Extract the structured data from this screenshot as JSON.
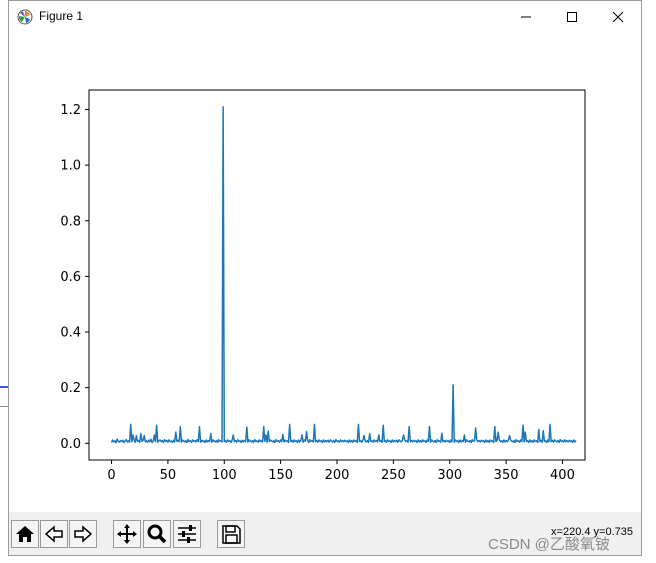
{
  "window": {
    "title": "Figure 1",
    "minimize_label": "–",
    "maximize_label": "☐",
    "close_label": "✕"
  },
  "toolbar": {
    "buttons": [
      {
        "name": "home-button",
        "icon": "home-icon"
      },
      {
        "name": "back-button",
        "icon": "arrow-left-icon"
      },
      {
        "name": "forward-button",
        "icon": "arrow-right-icon"
      },
      {
        "name": "pan-button",
        "icon": "move-icon"
      },
      {
        "name": "zoom-button",
        "icon": "magnifier-icon"
      },
      {
        "name": "configure-subplots-button",
        "icon": "sliders-icon"
      },
      {
        "name": "save-button",
        "icon": "floppy-disk-icon"
      }
    ],
    "coords": "x=220.4 y=0.735"
  },
  "watermark": "CSDN @乙酸氧铍",
  "chart_data": {
    "type": "line",
    "title": "",
    "xlabel": "",
    "ylabel": "",
    "xlim": [
      -20,
      420
    ],
    "ylim": [
      -0.06,
      1.27
    ],
    "xticks": [
      0,
      50,
      100,
      150,
      200,
      250,
      300,
      350,
      400
    ],
    "yticks": [
      0.0,
      0.2,
      0.4,
      0.6,
      0.8,
      1.0,
      1.2
    ],
    "ytick_labels": [
      "0.0",
      "0.2",
      "0.4",
      "0.6",
      "0.8",
      "1.0",
      "1.2"
    ],
    "line_color": "#1f77b4",
    "series": [
      {
        "x_start": 0,
        "x_step": 1,
        "values": [
          0.003,
          0.012,
          0.005,
          0.009,
          0.002,
          0.015,
          0.007,
          0.004,
          0.01,
          0.006,
          0.011,
          0.003,
          0.008,
          0.013,
          0.005,
          0.009,
          0.004,
          0.068,
          0.006,
          0.03,
          0.012,
          0.004,
          0.028,
          0.006,
          0.01,
          0.004,
          0.035,
          0.007,
          0.011,
          0.028,
          0.005,
          0.009,
          0.004,
          0.012,
          0.006,
          0.014,
          0.003,
          0.008,
          0.03,
          0.006,
          0.065,
          0.004,
          0.009,
          0.012,
          0.006,
          0.01,
          0.003,
          0.013,
          0.007,
          0.01,
          0.004,
          0.012,
          0.006,
          0.008,
          0.003,
          0.011,
          0.005,
          0.04,
          0.007,
          0.01,
          0.006,
          0.06,
          0.004,
          0.012,
          0.008,
          0.005,
          0.01,
          0.003,
          0.014,
          0.006,
          0.009,
          0.004,
          0.012,
          0.007,
          0.01,
          0.005,
          0.013,
          0.006,
          0.06,
          0.004,
          0.011,
          0.007,
          0.009,
          0.003,
          0.012,
          0.005,
          0.01,
          0.006,
          0.035,
          0.004,
          0.012,
          0.008,
          0.005,
          0.01,
          0.003,
          0.013,
          0.007,
          0.009,
          0.005,
          1.21,
          0.006,
          0.01,
          0.004,
          0.012,
          0.007,
          0.009,
          0.003,
          0.012,
          0.03,
          0.006,
          0.01,
          0.004,
          0.013,
          0.007,
          0.009,
          0.003,
          0.011,
          0.005,
          0.01,
          0.006,
          0.058,
          0.004,
          0.012,
          0.008,
          0.005,
          0.01,
          0.003,
          0.013,
          0.007,
          0.009,
          0.004,
          0.012,
          0.006,
          0.01,
          0.005,
          0.06,
          0.007,
          0.03,
          0.004,
          0.044,
          0.006,
          0.012,
          0.008,
          0.005,
          0.01,
          0.003,
          0.013,
          0.007,
          0.009,
          0.004,
          0.012,
          0.006,
          0.032,
          0.005,
          0.011,
          0.007,
          0.009,
          0.003,
          0.068,
          0.006,
          0.01,
          0.004,
          0.012,
          0.007,
          0.009,
          0.003,
          0.012,
          0.005,
          0.01,
          0.03,
          0.004,
          0.012,
          0.008,
          0.042,
          0.01,
          0.003,
          0.013,
          0.007,
          0.009,
          0.005,
          0.068,
          0.006,
          0.01,
          0.004,
          0.012,
          0.007,
          0.009,
          0.003,
          0.012,
          0.005,
          0.01,
          0.006,
          0.011,
          0.004,
          0.012,
          0.008,
          0.005,
          0.01,
          0.003,
          0.013,
          0.007,
          0.009,
          0.004,
          0.012,
          0.006,
          0.01,
          0.005,
          0.011,
          0.007,
          0.009,
          0.003,
          0.012,
          0.005,
          0.01,
          0.004,
          0.012,
          0.007,
          0.009,
          0.003,
          0.068,
          0.006,
          0.01,
          0.004,
          0.012,
          0.028,
          0.008,
          0.005,
          0.01,
          0.003,
          0.035,
          0.007,
          0.009,
          0.004,
          0.012,
          0.006,
          0.01,
          0.005,
          0.03,
          0.007,
          0.009,
          0.003,
          0.065,
          0.006,
          0.01,
          0.004,
          0.012,
          0.007,
          0.009,
          0.003,
          0.012,
          0.005,
          0.01,
          0.006,
          0.011,
          0.004,
          0.012,
          0.008,
          0.005,
          0.01,
          0.03,
          0.013,
          0.007,
          0.009,
          0.004,
          0.06,
          0.006,
          0.01,
          0.005,
          0.011,
          0.007,
          0.009,
          0.003,
          0.012,
          0.005,
          0.01,
          0.004,
          0.012,
          0.007,
          0.009,
          0.003,
          0.012,
          0.006,
          0.06,
          0.004,
          0.012,
          0.008,
          0.005,
          0.01,
          0.003,
          0.013,
          0.007,
          0.009,
          0.004,
          0.036,
          0.006,
          0.01,
          0.005,
          0.011,
          0.007,
          0.009,
          0.003,
          0.012,
          0.005,
          0.21,
          0.004,
          0.012,
          0.007,
          0.009,
          0.003,
          0.012,
          0.005,
          0.01,
          0.006,
          0.03,
          0.004,
          0.012,
          0.008,
          0.005,
          0.01,
          0.003,
          0.013,
          0.007,
          0.009,
          0.055,
          0.012,
          0.006,
          0.01,
          0.005,
          0.011,
          0.007,
          0.009,
          0.003,
          0.012,
          0.005,
          0.01,
          0.004,
          0.012,
          0.007,
          0.009,
          0.003,
          0.06,
          0.006,
          0.01,
          0.04,
          0.012,
          0.007,
          0.009,
          0.003,
          0.012,
          0.005,
          0.01,
          0.006,
          0.011,
          0.028,
          0.012,
          0.008,
          0.005,
          0.01,
          0.003,
          0.013,
          0.007,
          0.009,
          0.004,
          0.012,
          0.006,
          0.065,
          0.005,
          0.04,
          0.007,
          0.009,
          0.003,
          0.012,
          0.005,
          0.01,
          0.004,
          0.012,
          0.007,
          0.009,
          0.003,
          0.05,
          0.006,
          0.01,
          0.004,
          0.045,
          0.007,
          0.009,
          0.003,
          0.012,
          0.005,
          0.068,
          0.006,
          0.011,
          0.004,
          0.012,
          0.008,
          0.005,
          0.01,
          0.003,
          0.013,
          0.007,
          0.009,
          0.004,
          0.012,
          0.006,
          0.01,
          0.005,
          0.011,
          0.007,
          0.009,
          0.003,
          0.012,
          0.005,
          0.01
        ]
      }
    ]
  }
}
